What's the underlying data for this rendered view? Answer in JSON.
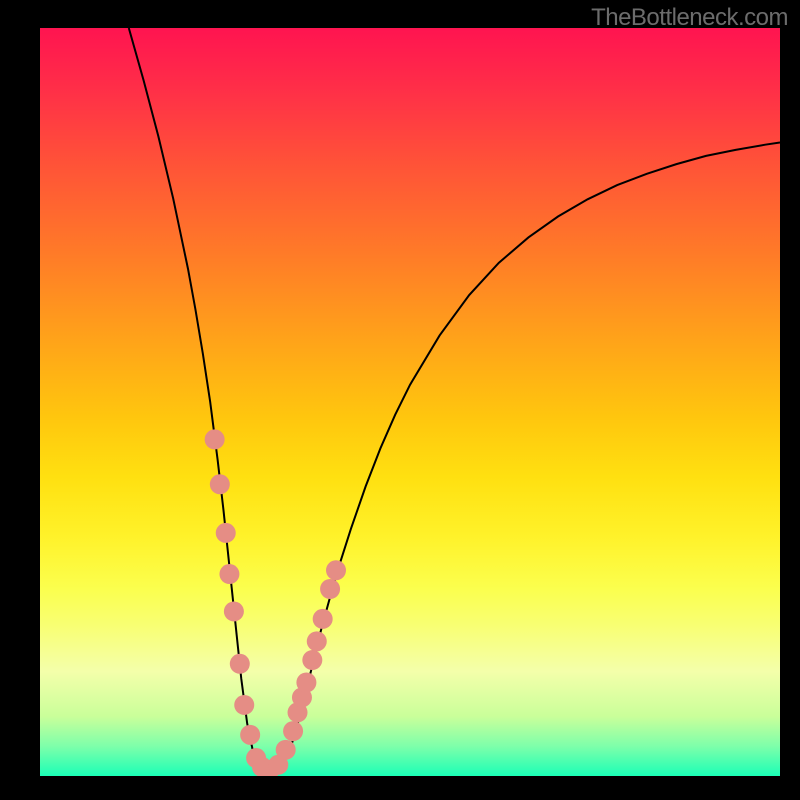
{
  "watermark": "TheBottleneck.com",
  "chart_data": {
    "type": "line",
    "title": "",
    "xlabel": "",
    "ylabel": "",
    "xlim": [
      0,
      100
    ],
    "ylim": [
      0,
      100
    ],
    "grid": false,
    "series": [
      {
        "name": "curve",
        "kind": "line",
        "x": [
          12,
          14,
          16,
          18,
          20,
          21,
          22,
          23,
          24,
          24.8,
          25.6,
          26.4,
          27.2,
          28,
          28.8,
          29.6,
          30.4,
          31,
          31.6,
          32.2,
          32.8,
          33.4,
          34,
          35,
          36,
          37,
          38,
          40,
          42,
          44,
          46,
          48,
          50,
          54,
          58,
          62,
          66,
          70,
          74,
          78,
          82,
          86,
          90,
          94,
          98,
          100
        ],
        "y": [
          100,
          93,
          85.5,
          77.2,
          67.8,
          62.4,
          56.5,
          50,
          42.3,
          35.5,
          28,
          20.5,
          13,
          7,
          3.2,
          1.4,
          0.6,
          0.4,
          0.45,
          0.8,
          1.6,
          2.7,
          4.2,
          7.6,
          11.5,
          15.6,
          19.6,
          26.8,
          33,
          38.7,
          43.8,
          48.3,
          52.3,
          58.9,
          64.3,
          68.6,
          72,
          74.8,
          77.1,
          79,
          80.5,
          81.8,
          82.9,
          83.7,
          84.4,
          84.7
        ]
      },
      {
        "name": "scatter",
        "kind": "scatter",
        "x": [
          23.6,
          24.3,
          25.1,
          25.6,
          26.2,
          27.0,
          27.6,
          28.4,
          29.2,
          30.0,
          31.0,
          32.2,
          33.2,
          34.2,
          34.8,
          35.4,
          36.0,
          36.8,
          37.4,
          38.2,
          39.2,
          40.0
        ],
        "y": [
          45.0,
          39.0,
          32.5,
          27.0,
          22.0,
          15.0,
          9.5,
          5.5,
          2.4,
          1.2,
          0.8,
          1.5,
          3.5,
          6.0,
          8.5,
          10.5,
          12.5,
          15.5,
          18.0,
          21.0,
          25.0,
          27.5
        ]
      }
    ]
  }
}
